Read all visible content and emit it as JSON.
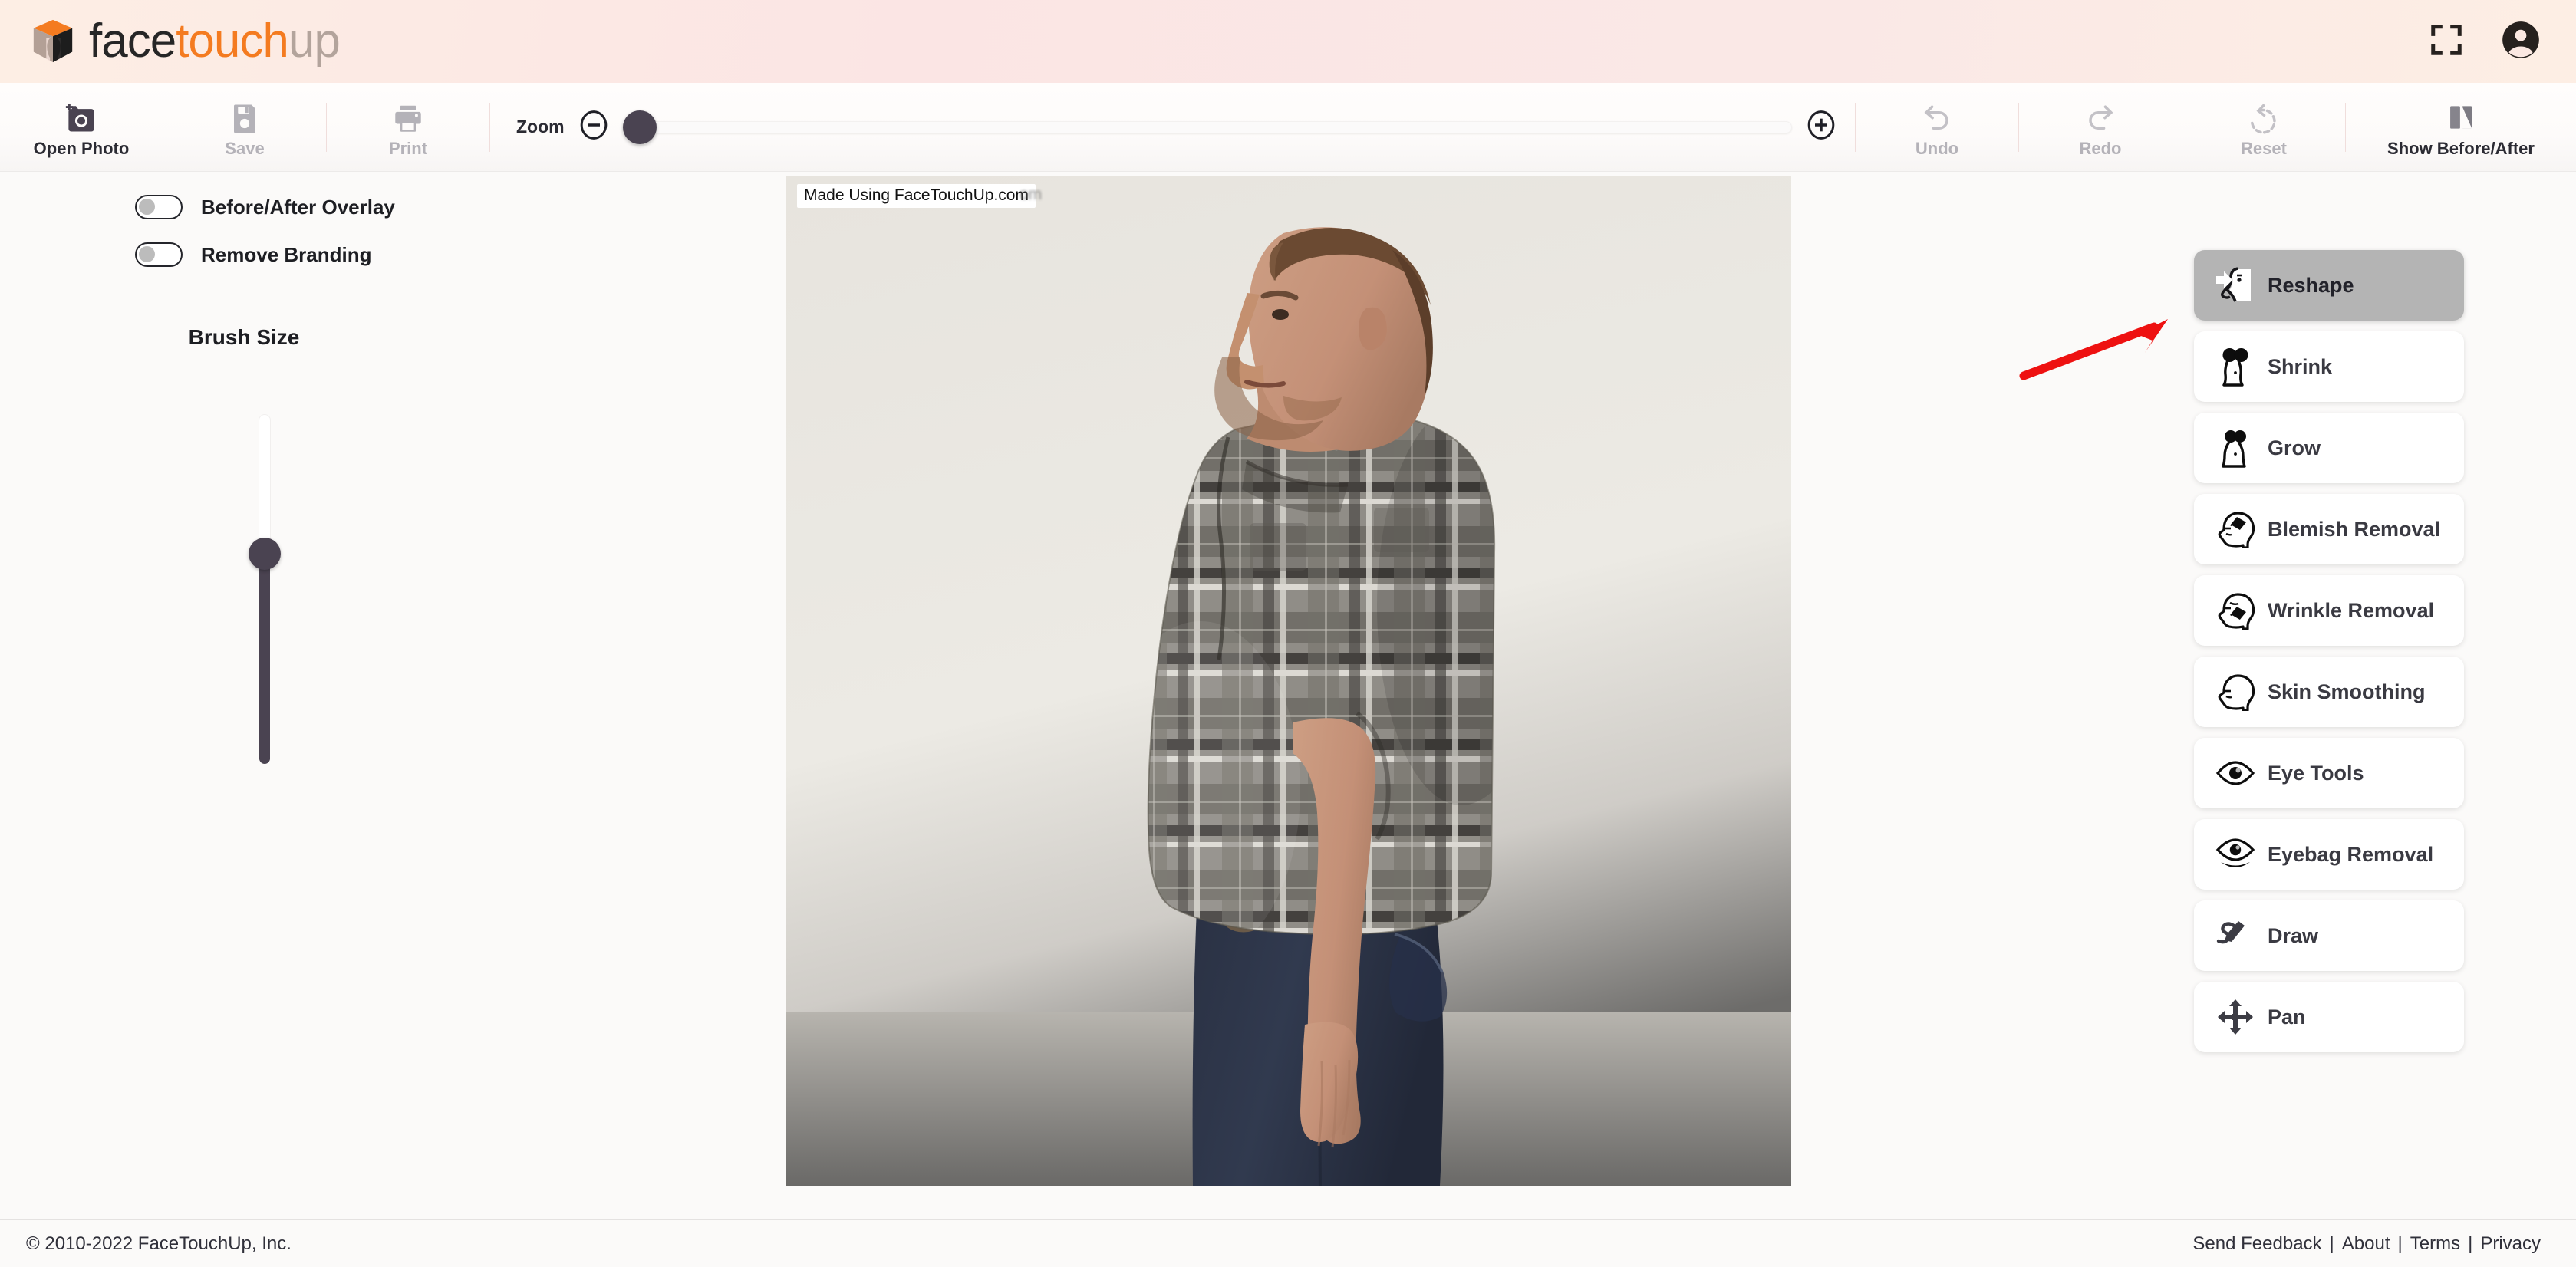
{
  "header": {
    "brand": {
      "part1": "face",
      "part2": "touch",
      "part3": "up",
      "logo_icon": "facetouchup-cube-logo"
    },
    "fullscreen_icon": "fullscreen-icon",
    "account_icon": "account-circle-icon",
    "background_color": "#fbe8e2"
  },
  "toolbar": {
    "open_photo": {
      "label": "Open Photo",
      "icon": "add-photo-icon",
      "enabled": true
    },
    "save": {
      "label": "Save",
      "icon": "floppy-disk-icon",
      "enabled": false
    },
    "print": {
      "label": "Print",
      "icon": "printer-icon",
      "enabled": false
    },
    "zoom": {
      "label": "Zoom",
      "minus_icon": "zoom-out-circle-icon",
      "plus_icon": "zoom-in-circle-icon",
      "value_percent": 0
    },
    "undo": {
      "label": "Undo",
      "icon": "undo-arrow-icon",
      "enabled": false
    },
    "redo": {
      "label": "Redo",
      "icon": "redo-arrow-icon",
      "enabled": false
    },
    "reset": {
      "label": "Reset",
      "icon": "reset-arrow-icon",
      "enabled": false
    },
    "show_before_after": {
      "label": "Show Before/After",
      "icon": "before-after-split-icon",
      "enabled": true
    }
  },
  "left_panel": {
    "toggles": [
      {
        "label": "Before/After Overlay",
        "on": false
      },
      {
        "label": "Remove Branding",
        "on": false
      }
    ],
    "brush_size": {
      "label": "Brush Size",
      "value_percent": 40
    }
  },
  "canvas": {
    "watermark_text": "Made Using FaceTouchUp.com",
    "watermark_ghost_text": "om",
    "photo_description": "Side profile photo of a man with a large belly wearing a grey plaid short-sleeve shirt and dark blue jeans, standing against a plain light grey studio backdrop"
  },
  "tool_rail": {
    "selected": "Reshape",
    "tools": [
      {
        "label": "Reshape",
        "icon": "reshape-face-profile-icon",
        "selected": true
      },
      {
        "label": "Shrink",
        "icon": "shrink-torso-icon",
        "selected": false
      },
      {
        "label": "Grow",
        "icon": "grow-torso-icon",
        "selected": false
      },
      {
        "label": "Blemish Removal",
        "icon": "blemish-removal-head-eraser-icon",
        "selected": false
      },
      {
        "label": "Wrinkle Removal",
        "icon": "wrinkle-removal-head-eraser-icon",
        "selected": false
      },
      {
        "label": "Skin Smoothing",
        "icon": "skin-smoothing-head-icon",
        "selected": false
      },
      {
        "label": "Eye Tools",
        "icon": "eye-icon",
        "selected": false
      },
      {
        "label": "Eyebag Removal",
        "icon": "eyebag-eye-icon",
        "selected": false
      },
      {
        "label": "Draw",
        "icon": "pencil-draw-icon",
        "selected": false
      },
      {
        "label": "Pan",
        "icon": "move-arrows-icon",
        "selected": false
      }
    ]
  },
  "annotation": {
    "arrow_icon": "red-pointer-arrow",
    "color": "#ee1111",
    "points_at": "Reshape"
  },
  "footer": {
    "copyright": "© 2010-2022 FaceTouchUp, Inc.",
    "links": [
      "Send Feedback",
      "About",
      "Terms",
      "Privacy"
    ],
    "separator": "|"
  }
}
